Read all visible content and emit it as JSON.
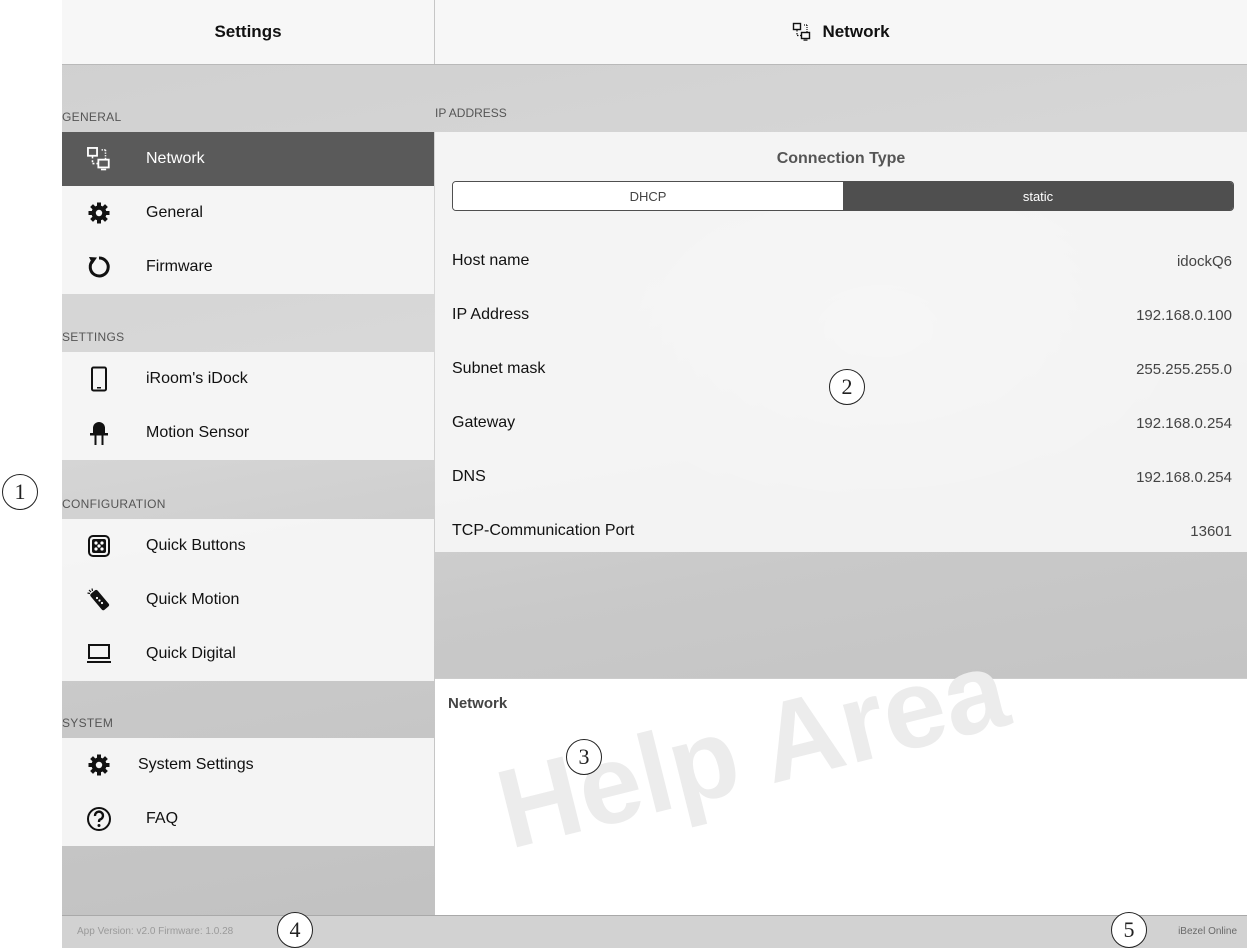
{
  "header": {
    "left_title": "Settings",
    "right_title": "Network",
    "right_icon": "network-icon"
  },
  "sidebar": {
    "sections": [
      {
        "label": "GENERAL",
        "items": [
          {
            "label": "Network",
            "icon": "network-icon",
            "active": true
          },
          {
            "label": "General",
            "icon": "gear-icon"
          },
          {
            "label": "Firmware",
            "icon": "refresh-icon"
          }
        ]
      },
      {
        "label": "SETTINGS",
        "items": [
          {
            "label": "iRoom's iDock",
            "icon": "tablet-icon"
          },
          {
            "label": "Motion Sensor",
            "icon": "sensor-icon"
          }
        ]
      },
      {
        "label": "CONFIGURATION",
        "items": [
          {
            "label": "Quick Buttons",
            "icon": "dice-icon"
          },
          {
            "label": "Quick Motion",
            "icon": "remote-icon"
          },
          {
            "label": "Quick Digital",
            "icon": "monitor-icon"
          }
        ]
      },
      {
        "label": "SYSTEM",
        "items": [
          {
            "label": "System Settings",
            "icon": "gear-icon"
          },
          {
            "label": "FAQ",
            "icon": "question-icon"
          }
        ]
      }
    ]
  },
  "main": {
    "section_label": "IP ADDRESS",
    "connection_type": {
      "title": "Connection Type",
      "options": [
        "DHCP",
        "static"
      ],
      "selected": "static"
    },
    "fields": [
      {
        "label": "Host name",
        "value": "idockQ6"
      },
      {
        "label": "IP Address",
        "value": "192.168.0.100"
      },
      {
        "label": "Subnet mask",
        "value": "255.255.255.0"
      },
      {
        "label": "Gateway",
        "value": "192.168.0.254"
      },
      {
        "label": "DNS",
        "value": "192.168.0.254"
      },
      {
        "label": "TCP-Communication Port",
        "value": "13601"
      }
    ]
  },
  "help": {
    "title": "Network",
    "watermark": "Help Area"
  },
  "footer": {
    "version": "App Version: v2.0 Firmware: 1.0.28",
    "status": "iBezel Online"
  },
  "callouts": [
    "1",
    "2",
    "3",
    "4",
    "5"
  ],
  "colors": {
    "active_item": "#5a5a5a",
    "segment_selected": "#4f4f4f"
  }
}
